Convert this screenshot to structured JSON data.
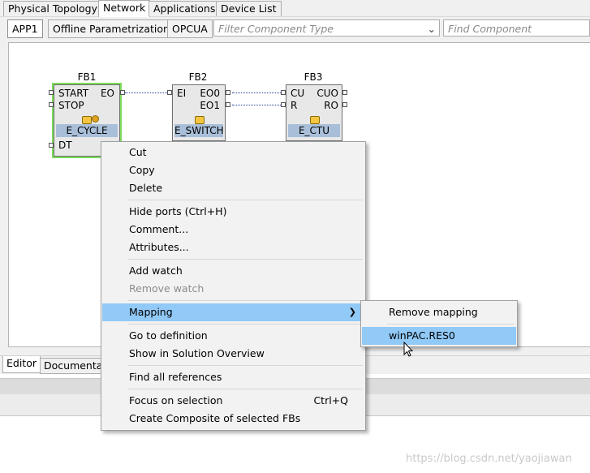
{
  "top_tabs": [
    "Physical Topology",
    "Network",
    "Applications",
    "Device List"
  ],
  "subbar": {
    "app_button": "APP1",
    "offline_button": "Offline Parametrization",
    "opcua_button": "OPCUA",
    "filter_placeholder": "Filter Component Type",
    "find_placeholder": "Find Component"
  },
  "blocks": {
    "fb1": {
      "name": "FB1",
      "type": "E_CYCLE",
      "in1": "START",
      "in2": "STOP",
      "out1": "EO",
      "data_in": "DT"
    },
    "fb2": {
      "name": "FB2",
      "type": "E_SWITCH",
      "in1": "EI",
      "out1": "EO0",
      "out2": "EO1"
    },
    "fb3": {
      "name": "FB3",
      "type": "E_CTU",
      "in1": "CU",
      "in2": "R",
      "out1": "CUO",
      "out2": "RO"
    }
  },
  "bottom_tabs": [
    "Editor",
    "Documentat"
  ],
  "context_menu": {
    "cut": "Cut",
    "copy": "Copy",
    "delete": "Delete",
    "hide_ports": "Hide ports (Ctrl+H)",
    "comment": "Comment...",
    "attributes": "Attributes...",
    "add_watch": "Add watch",
    "remove_watch": "Remove watch",
    "mapping": "Mapping",
    "go_to_definition": "Go to definition",
    "show_in_solution": "Show in Solution Overview",
    "find_refs": "Find all references",
    "focus": "Focus on selection",
    "focus_shortcut": "Ctrl+Q",
    "create_composite": "Create Composite of selected FBs"
  },
  "submenu": {
    "remove_mapping": "Remove mapping",
    "target": "winPAC.RES0"
  },
  "watermark": "https://blog.csdn.net/yaojiawan",
  "colors": {
    "highlight": "#91c9f7",
    "selection_outline": "#7ddc5a",
    "type_band": "#a9bfd9"
  }
}
